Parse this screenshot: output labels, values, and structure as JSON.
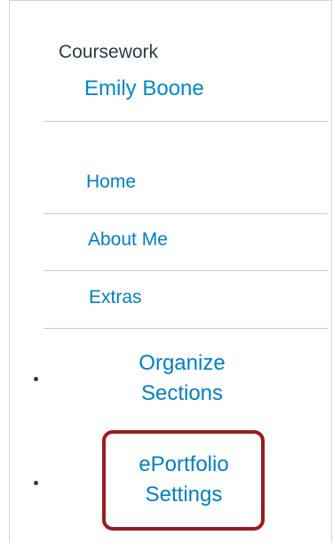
{
  "portfolio": {
    "section_title": "Coursework",
    "owner_name": "Emily Boone"
  },
  "nav": {
    "items": [
      {
        "label": "Home"
      },
      {
        "label": "About Me"
      },
      {
        "label": "Extras"
      }
    ]
  },
  "actions": {
    "organize_line1": "Organize",
    "organize_line2": "Sections",
    "settings_line1": "ePortfolio",
    "settings_line2": "Settings"
  },
  "colors": {
    "link": "#0080c4",
    "highlight": "#9b1c1f"
  }
}
